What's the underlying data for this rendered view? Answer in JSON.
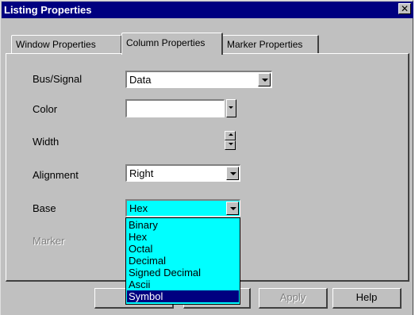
{
  "window": {
    "title": "Listing Properties",
    "close_glyph": "✕"
  },
  "tabs": [
    {
      "label": "Window Properties",
      "active": false
    },
    {
      "label": "Column Properties",
      "active": true
    },
    {
      "label": "Marker Properties",
      "active": false
    }
  ],
  "form": {
    "bus_signal": {
      "label": "Bus/Signal",
      "value": "Data"
    },
    "color": {
      "label": "Color",
      "value": "#ffffff"
    },
    "width": {
      "label": "Width"
    },
    "alignment": {
      "label": "Alignment",
      "value": "Right"
    },
    "base": {
      "label": "Base",
      "value": "Hex",
      "options": [
        "Binary",
        "Hex",
        "Octal",
        "Decimal",
        "Signed Decimal",
        "Ascii",
        "Symbol"
      ],
      "highlighted": "Symbol"
    },
    "marker": {
      "label": "Marker",
      "enabled": false
    }
  },
  "buttons": {
    "apply": {
      "label": "Apply",
      "enabled": false
    },
    "help": {
      "label": "Help"
    }
  },
  "colors": {
    "titlebar": "#000080",
    "dropdown_list": "#00ffff",
    "selection": "#000080",
    "face": "#c0c0c0"
  }
}
